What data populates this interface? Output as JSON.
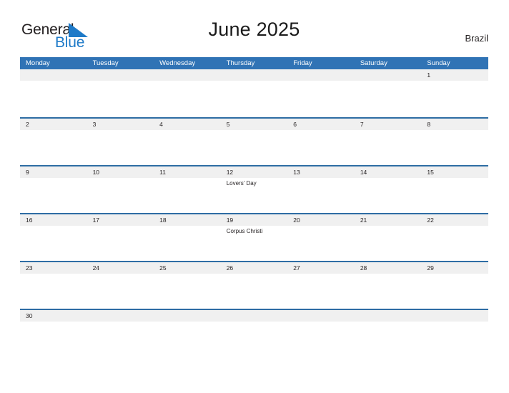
{
  "brand": {
    "name_part1": "General",
    "name_part2": "Blue",
    "flag_icon": "blue-triangle-flag",
    "color_dark": "#231f20",
    "color_blue": "#1e7ac8"
  },
  "header": {
    "title": "June 2025",
    "region": "Brazil"
  },
  "theme": {
    "header_blue": "#3073b5",
    "row_divider_blue": "#2e6da4",
    "day_strip_gray": "#f0f0f0",
    "text_dark": "#231f20",
    "page_background": "#ffffff"
  },
  "calendar": {
    "month": "June",
    "year": "2025",
    "weekday_headers": [
      "Monday",
      "Tuesday",
      "Wednesday",
      "Thursday",
      "Friday",
      "Saturday",
      "Sunday"
    ],
    "weeks": [
      [
        {
          "date": "",
          "events": []
        },
        {
          "date": "",
          "events": []
        },
        {
          "date": "",
          "events": []
        },
        {
          "date": "",
          "events": []
        },
        {
          "date": "",
          "events": []
        },
        {
          "date": "",
          "events": []
        },
        {
          "date": "1",
          "events": []
        }
      ],
      [
        {
          "date": "2",
          "events": []
        },
        {
          "date": "3",
          "events": []
        },
        {
          "date": "4",
          "events": []
        },
        {
          "date": "5",
          "events": []
        },
        {
          "date": "6",
          "events": []
        },
        {
          "date": "7",
          "events": []
        },
        {
          "date": "8",
          "events": []
        }
      ],
      [
        {
          "date": "9",
          "events": []
        },
        {
          "date": "10",
          "events": []
        },
        {
          "date": "11",
          "events": []
        },
        {
          "date": "12",
          "events": [
            "Lovers' Day"
          ]
        },
        {
          "date": "13",
          "events": []
        },
        {
          "date": "14",
          "events": []
        },
        {
          "date": "15",
          "events": []
        }
      ],
      [
        {
          "date": "16",
          "events": []
        },
        {
          "date": "17",
          "events": []
        },
        {
          "date": "18",
          "events": []
        },
        {
          "date": "19",
          "events": [
            "Corpus Christi"
          ]
        },
        {
          "date": "20",
          "events": []
        },
        {
          "date": "21",
          "events": []
        },
        {
          "date": "22",
          "events": []
        }
      ],
      [
        {
          "date": "23",
          "events": []
        },
        {
          "date": "24",
          "events": []
        },
        {
          "date": "25",
          "events": []
        },
        {
          "date": "26",
          "events": []
        },
        {
          "date": "27",
          "events": []
        },
        {
          "date": "28",
          "events": []
        },
        {
          "date": "29",
          "events": []
        }
      ],
      [
        {
          "date": "30",
          "events": []
        },
        {
          "date": "",
          "events": []
        },
        {
          "date": "",
          "events": []
        },
        {
          "date": "",
          "events": []
        },
        {
          "date": "",
          "events": []
        },
        {
          "date": "",
          "events": []
        },
        {
          "date": "",
          "events": []
        }
      ]
    ]
  }
}
